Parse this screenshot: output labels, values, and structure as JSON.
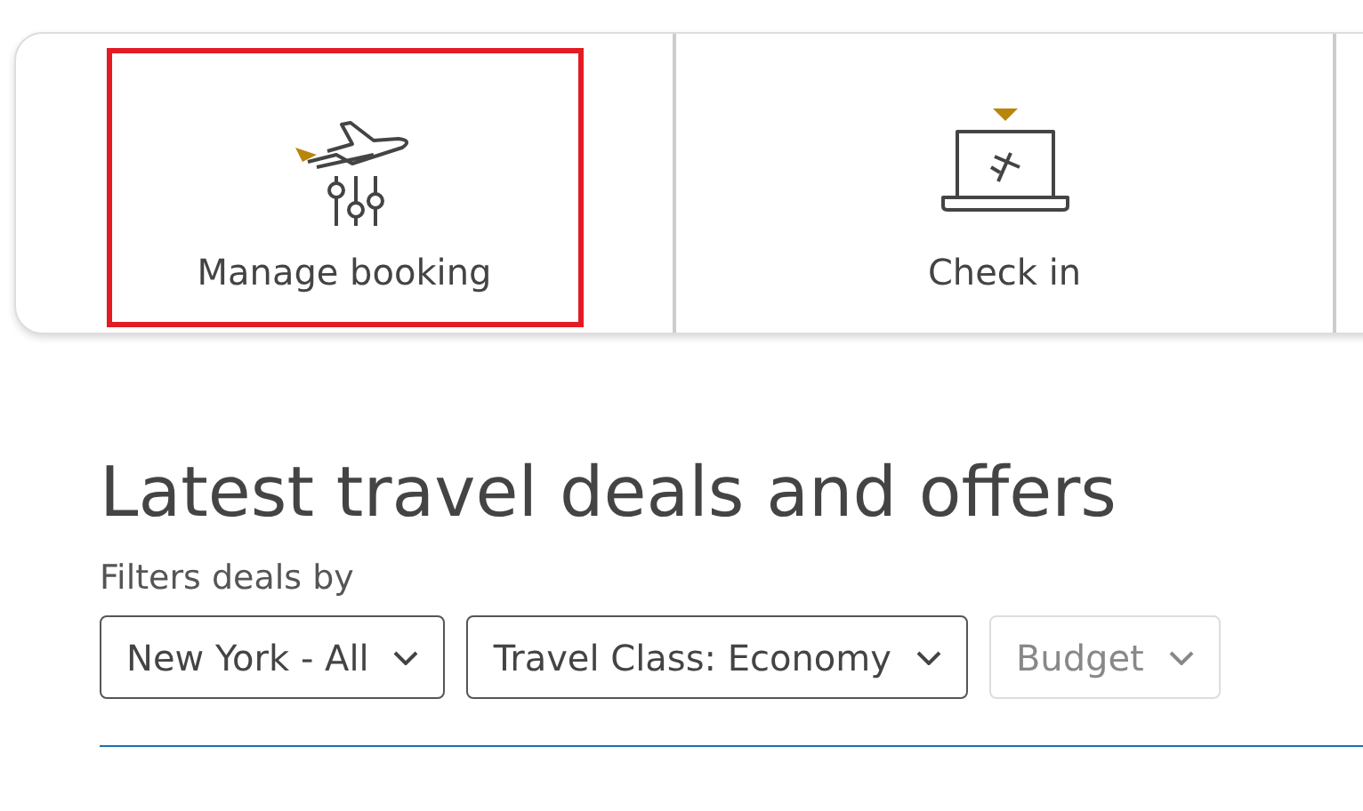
{
  "quick_links": [
    {
      "kind": "manage",
      "label": "Manage booking",
      "highlighted": true
    },
    {
      "kind": "checkin",
      "label": "Check in",
      "highlighted": false
    }
  ],
  "heading": "Latest travel deals and offers",
  "filters_label": "Filters deals by",
  "filters": [
    {
      "label": "New York - All",
      "disabled": false
    },
    {
      "label": "Travel Class: Economy",
      "disabled": false
    },
    {
      "label": "Budget",
      "disabled": true
    }
  ]
}
